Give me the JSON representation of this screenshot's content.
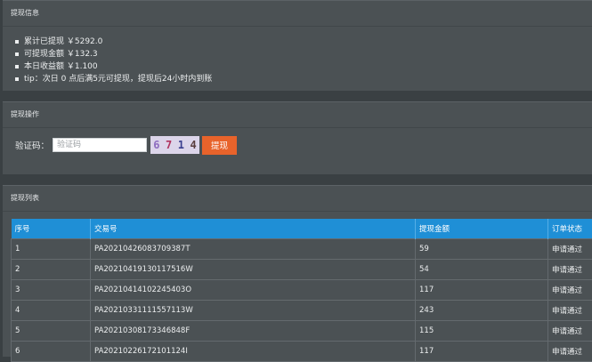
{
  "info_panel": {
    "title": "提现信息",
    "items": [
      "累计已提现 ￥5292.0",
      "可提现金额 ￥132.3",
      "本日收益额 ￥1.100",
      "tip：次日 0 点后满5元可提现，提现后24小时内到账"
    ]
  },
  "operation_panel": {
    "title": "提现操作",
    "captcha_label": "验证码：",
    "captcha_placeholder": "验证码",
    "captcha_chars": [
      "6",
      "7",
      "1",
      "4"
    ],
    "submit_label": "提现"
  },
  "list_panel": {
    "title": "提现列表",
    "columns": [
      "序号",
      "交易号",
      "提现金额",
      "订单状态"
    ],
    "rows": [
      [
        "1",
        "PA20210426083709387T",
        "59",
        "申请通过"
      ],
      [
        "2",
        "PA20210419130117516W",
        "54",
        "申请通过"
      ],
      [
        "3",
        "PA20210414102245403O",
        "117",
        "申请通过"
      ],
      [
        "4",
        "PA20210331111557113W",
        "243",
        "申请通过"
      ],
      [
        "5",
        "PA20210308173346848F",
        "115",
        "申请通过"
      ],
      [
        "6",
        "PA20210226172101124I",
        "117",
        "申请通过"
      ]
    ]
  },
  "colors": {
    "accent_button": "#e8632b",
    "table_header": "#1f8fd6",
    "panel_bg": "#4b5154"
  }
}
